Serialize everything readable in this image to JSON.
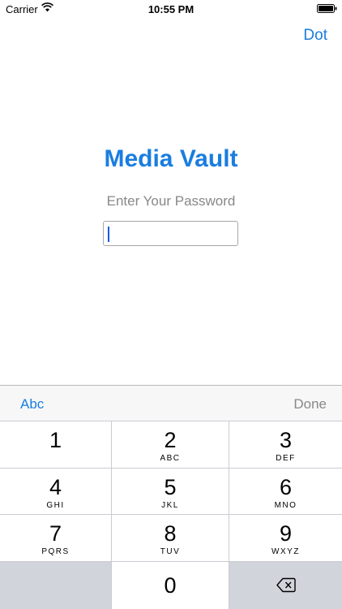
{
  "status_bar": {
    "carrier": "Carrier",
    "time": "10:55 PM"
  },
  "nav": {
    "dot_label": "Dot"
  },
  "main": {
    "title": "Media Vault",
    "prompt": "Enter Your Password"
  },
  "toolbar": {
    "abc_label": "Abc",
    "done_label": "Done"
  },
  "keypad": {
    "k1": {
      "digit": "1",
      "letters": ""
    },
    "k2": {
      "digit": "2",
      "letters": "ABC"
    },
    "k3": {
      "digit": "3",
      "letters": "DEF"
    },
    "k4": {
      "digit": "4",
      "letters": "GHI"
    },
    "k5": {
      "digit": "5",
      "letters": "JKL"
    },
    "k6": {
      "digit": "6",
      "letters": "MNO"
    },
    "k7": {
      "digit": "7",
      "letters": "PQRS"
    },
    "k8": {
      "digit": "8",
      "letters": "TUV"
    },
    "k9": {
      "digit": "9",
      "letters": "WXYZ"
    },
    "k0": {
      "digit": "0",
      "letters": ""
    }
  },
  "icons": {
    "wifi": "wifi-icon",
    "battery": "battery-icon",
    "backspace": "backspace-icon"
  },
  "colors": {
    "accent": "#1a7de0",
    "muted": "#888888",
    "keypad_bg": "#c9ccd2"
  }
}
